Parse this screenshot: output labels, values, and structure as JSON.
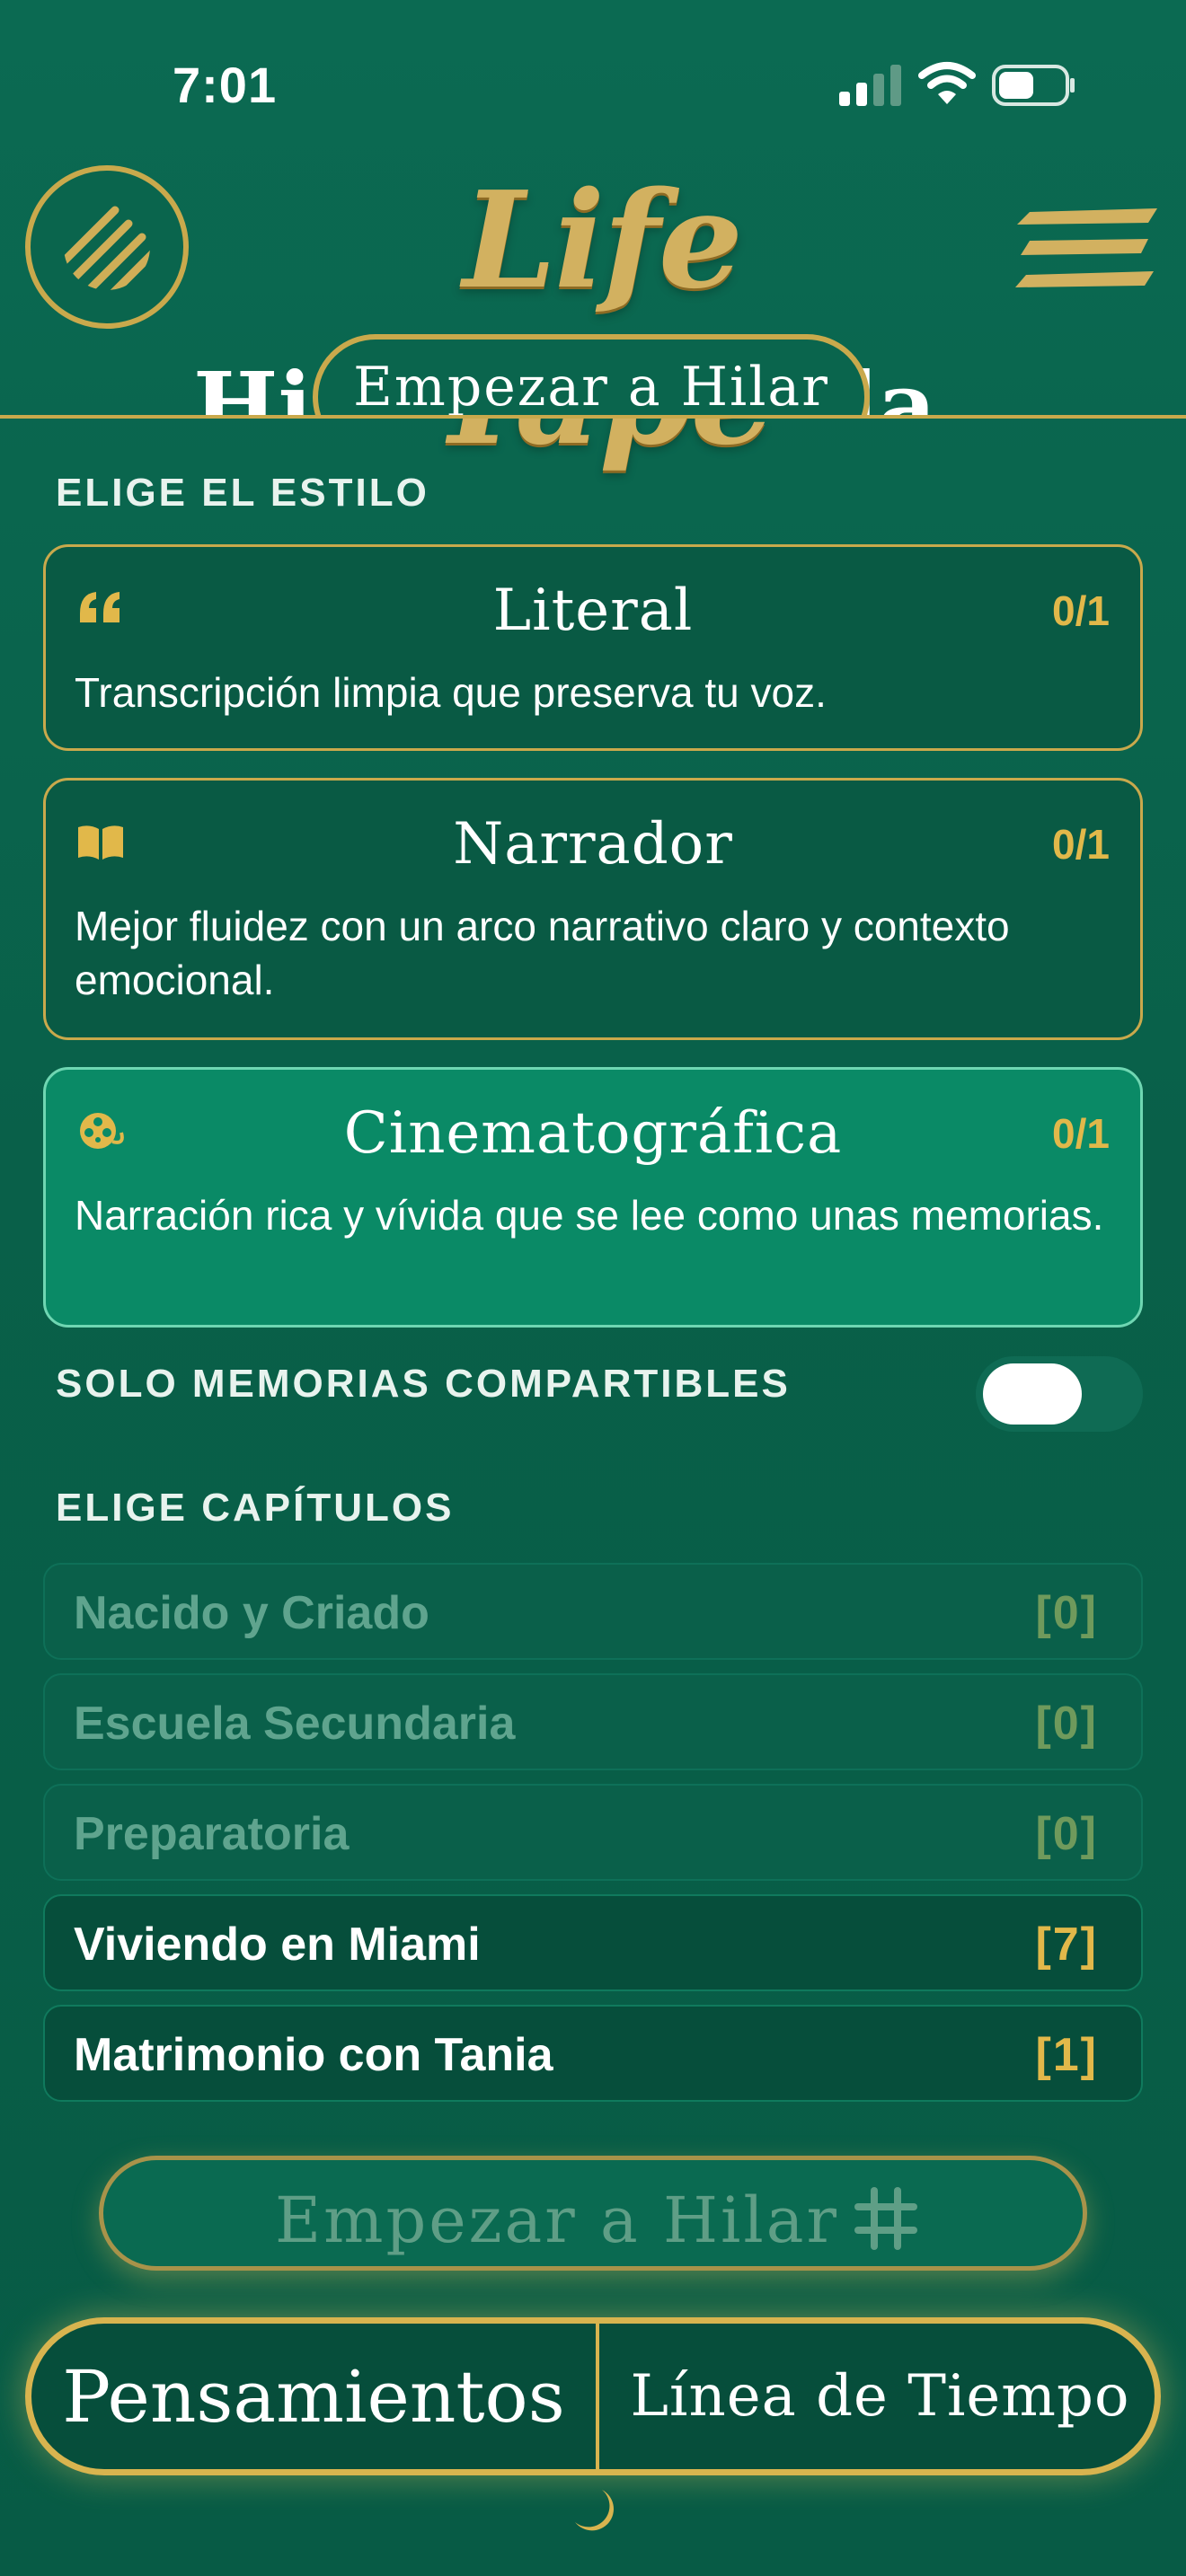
{
  "status_bar": {
    "time": "7:01"
  },
  "header": {
    "app_title": "Life Tape",
    "peek_title_left": "Hi",
    "peek_title_right": "da",
    "peek_pill_label": "Empezar a Hilar"
  },
  "style_section": {
    "label": "ELIGE EL ESTILO",
    "cards": [
      {
        "title": "Literal",
        "count": "0/1",
        "description": "Transcripción limpia que preserva tu voz.",
        "icon": "quote-icon"
      },
      {
        "title": "Narrador",
        "count": "0/1",
        "description": "Mejor fluidez con un arco narrativo claro y contexto emocional.",
        "icon": "book-icon"
      },
      {
        "title": "Cinematográfica",
        "count": "0/1",
        "description": "Narración rica y vívida que se lee como unas memorias.",
        "icon": "film-reel-icon"
      }
    ]
  },
  "shareable_toggle": {
    "label": "SOLO MEMORIAS COMPARTIBLES",
    "state": "off"
  },
  "chapters_section": {
    "label": "ELIGE CAPÍTULOS",
    "rows": [
      {
        "name": "Nacido y Criado",
        "count": "[0]"
      },
      {
        "name": "Escuela Secundaria",
        "count": "[0]"
      },
      {
        "name": "Preparatoria",
        "count": "[0]"
      },
      {
        "name": "Viviendo en Miami",
        "count": "[7]"
      },
      {
        "name": "Matrimonio con Tania",
        "count": "[1]"
      }
    ]
  },
  "start_button": {
    "label": "Empezar a Hilar"
  },
  "bottom_nav": {
    "left_tab": "Pensamientos",
    "right_tab": "Línea de Tiempo"
  },
  "colors": {
    "background": "#0b6a52",
    "gold": "#c9a94c",
    "selected_card": "#0a8a66",
    "count_gold": "#e1b84a"
  }
}
